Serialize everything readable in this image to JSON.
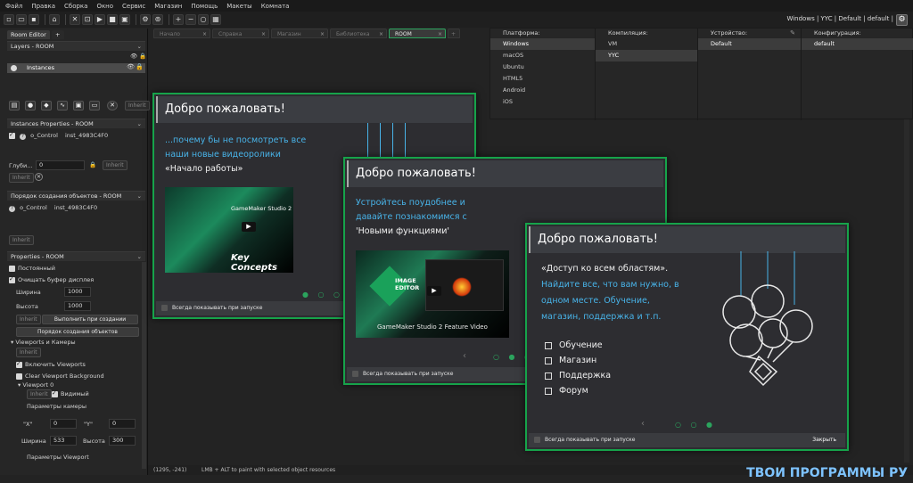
{
  "menu": [
    "Файл",
    "Правка",
    "Сборка",
    "Окно",
    "Сервис",
    "Магазин",
    "Помощь",
    "Макеты",
    "Комната"
  ],
  "toolbar_right": "Windows | YYC | Default | default |",
  "room_editor_tab": "Room Editor",
  "layers_header": "Layers - ROOM",
  "layer_instances": "Instances",
  "inherit_label": "Inherit",
  "instances_props_header": "Instances Properties - ROOM",
  "instance_row": {
    "name": "o_Control",
    "id": "inst_4983C4F0"
  },
  "depth_label": "Глуби...",
  "depth_value": "0",
  "creation_order_header": "Порядок создания объектов - ROOM",
  "properties_header": "Properties - ROOM",
  "persistent_label": "Постоянный",
  "clear_buffer_label": "Очищать буфер дисплея",
  "width_label": "Ширина",
  "width_value": "1000",
  "height_label": "Высота",
  "height_value": "1000",
  "run_on_create_label": "Выполнить при создании",
  "creation_order_btn": "Порядок создания объектов",
  "viewports_label": "Viewports и Камеры",
  "enable_viewports_label": "Включить Viewports",
  "clear_viewport_bg_label": "Clear Viewport Background",
  "viewport0_label": "Viewport 0",
  "visible_label": "Видимый",
  "camera_params_label": "Параметры камеры",
  "x_label": "\"X\"",
  "x_value": "0",
  "y_label": "\"Y\"",
  "y_value": "0",
  "cam_width_label": "Ширина",
  "cam_width_value": "533",
  "cam_height_label": "Высота",
  "cam_height_value": "300",
  "viewport_params_label": "Параметры Viewport",
  "doc_tabs": [
    "Начало",
    "Справка",
    "Магазин",
    "Библиотека",
    "ROOM"
  ],
  "platforms": {
    "platform_header": "Платформа:",
    "platform_items": [
      "Windows",
      "macOS",
      "Ubuntu",
      "HTML5",
      "Android",
      "iOS"
    ],
    "compile_header": "Компиляция:",
    "compile_items": [
      "VM",
      "YYC"
    ],
    "device_header": "Устройство:",
    "device_items": [
      "Default"
    ],
    "config_header": "Конфигурация:",
    "config_items": [
      "default"
    ]
  },
  "dialog1": {
    "title": "Добро пожаловать!",
    "line1": "...почему бы не посмотреть все",
    "line2": "наши новые видеоролики",
    "line3": "«Начало работы»",
    "video_brand": "GameMaker Studio 2",
    "video_title": "Key Concepts",
    "footer": "Всегда показывать при запуске"
  },
  "dialog2": {
    "title": "Добро пожаловать!",
    "line1": "Устройтесь поудобнее и",
    "line2": "давайте познакомимся с",
    "line3": "'Новыми функциями'",
    "badge_line1": "IMAGE",
    "badge_line2": "EDITOR",
    "video_caption": "GameMaker Studio 2 Feature Video",
    "footer": "Всегда показывать при запуске"
  },
  "dialog3": {
    "title": "Добро пожаловать!",
    "line1": "«Доступ ко всем областям».",
    "line2": "Найдите все, что вам нужно, в",
    "line3": "одном месте. Обучение,",
    "line4": "магазин, поддержка и т.п.",
    "links": [
      "Обучение",
      "Магазин",
      "Поддержка",
      "Форум"
    ],
    "footer": "Всегда показывать при запуске",
    "close": "Закрыть"
  },
  "status_coords": "(1295, -241)",
  "status_hint": "LMB + ALT to paint with selected object resources",
  "watermark": "ТВОИ ПРОГРАММЫ РУ",
  "colors": {
    "accent": "#16a34a",
    "link": "#48b3e8",
    "bg": "#232323"
  }
}
